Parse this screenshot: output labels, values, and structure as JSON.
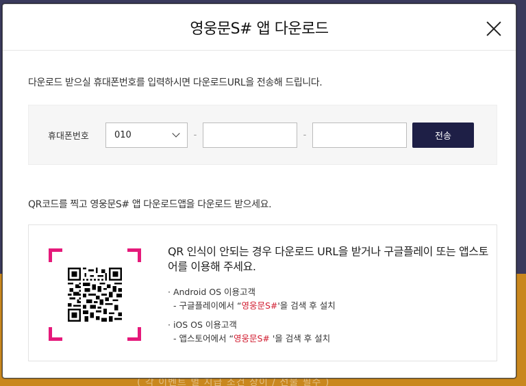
{
  "background": {
    "bottom_text": "( 각 이벤트 별 지급 조건 상이 / 선물 필수 )"
  },
  "modal": {
    "title": "영웅문S# 앱 다운로드",
    "description": "다운로드 받으실 휴대폰번호를 입력하시면 다운로드URL을 전송해 드립니다.",
    "phone": {
      "label": "휴대폰번호",
      "prefix_selected": "010",
      "dash": "-",
      "middle_value": "",
      "last_value": "",
      "send_label": "전송"
    },
    "qr_description": "QR코드를 찍고 영웅문S# 앱 다운로드앱을 다운로드 받으세요.",
    "qr_info": {
      "headline": "QR 인식이 안되는 경우 다운로드 URL을 받거나 구글플레이 또는 앱스토어를 이용해 주세요.",
      "android": {
        "title": "· Android OS 이용고객",
        "line_prefix": "- 구글플레이에서 “",
        "line_highlight": "영웅문S#",
        "line_suffix": "'을 검색 후 설치"
      },
      "ios": {
        "title": "· iOS OS 이용고객",
        "line_prefix": "- 앱스토어에서 “",
        "line_highlight": "영웅문S# ",
        "line_suffix": "'을 검색 후 설치"
      }
    }
  },
  "colors": {
    "accent_pink": "#e5197a",
    "button_navy": "#1e1f46",
    "highlight_red": "#d11b2f"
  }
}
